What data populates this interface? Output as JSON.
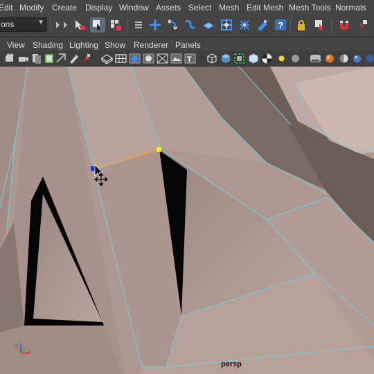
{
  "menubar": {
    "items": [
      "Edit",
      "Modify",
      "Create",
      "Display",
      "Window",
      "Assets",
      "Select",
      "Mesh",
      "Edit Mesh",
      "Mesh Tools",
      "Normals"
    ]
  },
  "shelf": {
    "mode_selector_value": "ons",
    "tools": [
      "select-by-hierarchy-icon",
      "select-object-icon",
      "select-component-icon",
      "snap-grid-icon",
      "snap-curve-icon",
      "snap-point-icon",
      "snap-view-plane-icon",
      "snap-live-icon",
      "construction-history-icon",
      "render-frame-icon",
      "ipr-render-icon",
      "render-settings-icon",
      "help-icon",
      "lock-icon",
      "select-highlight-icon",
      "magnet-icon",
      "symmetry-icon"
    ]
  },
  "panel_menu": {
    "items": [
      "View",
      "Shading",
      "Lighting",
      "Show",
      "Renderer",
      "Panels"
    ]
  },
  "viewport": {
    "camera_label": "persp",
    "edge_highlight_color": "#ff9a3c",
    "wire_color": "#6fd0e6",
    "selected_vertex_color": "#f2ea2b",
    "hover_vertex_color": "#1f3cd6"
  },
  "colors": {
    "menubar_bg": "#444444",
    "shelf_active": "#5d6d7d",
    "mesh_base": "#a88f86"
  }
}
